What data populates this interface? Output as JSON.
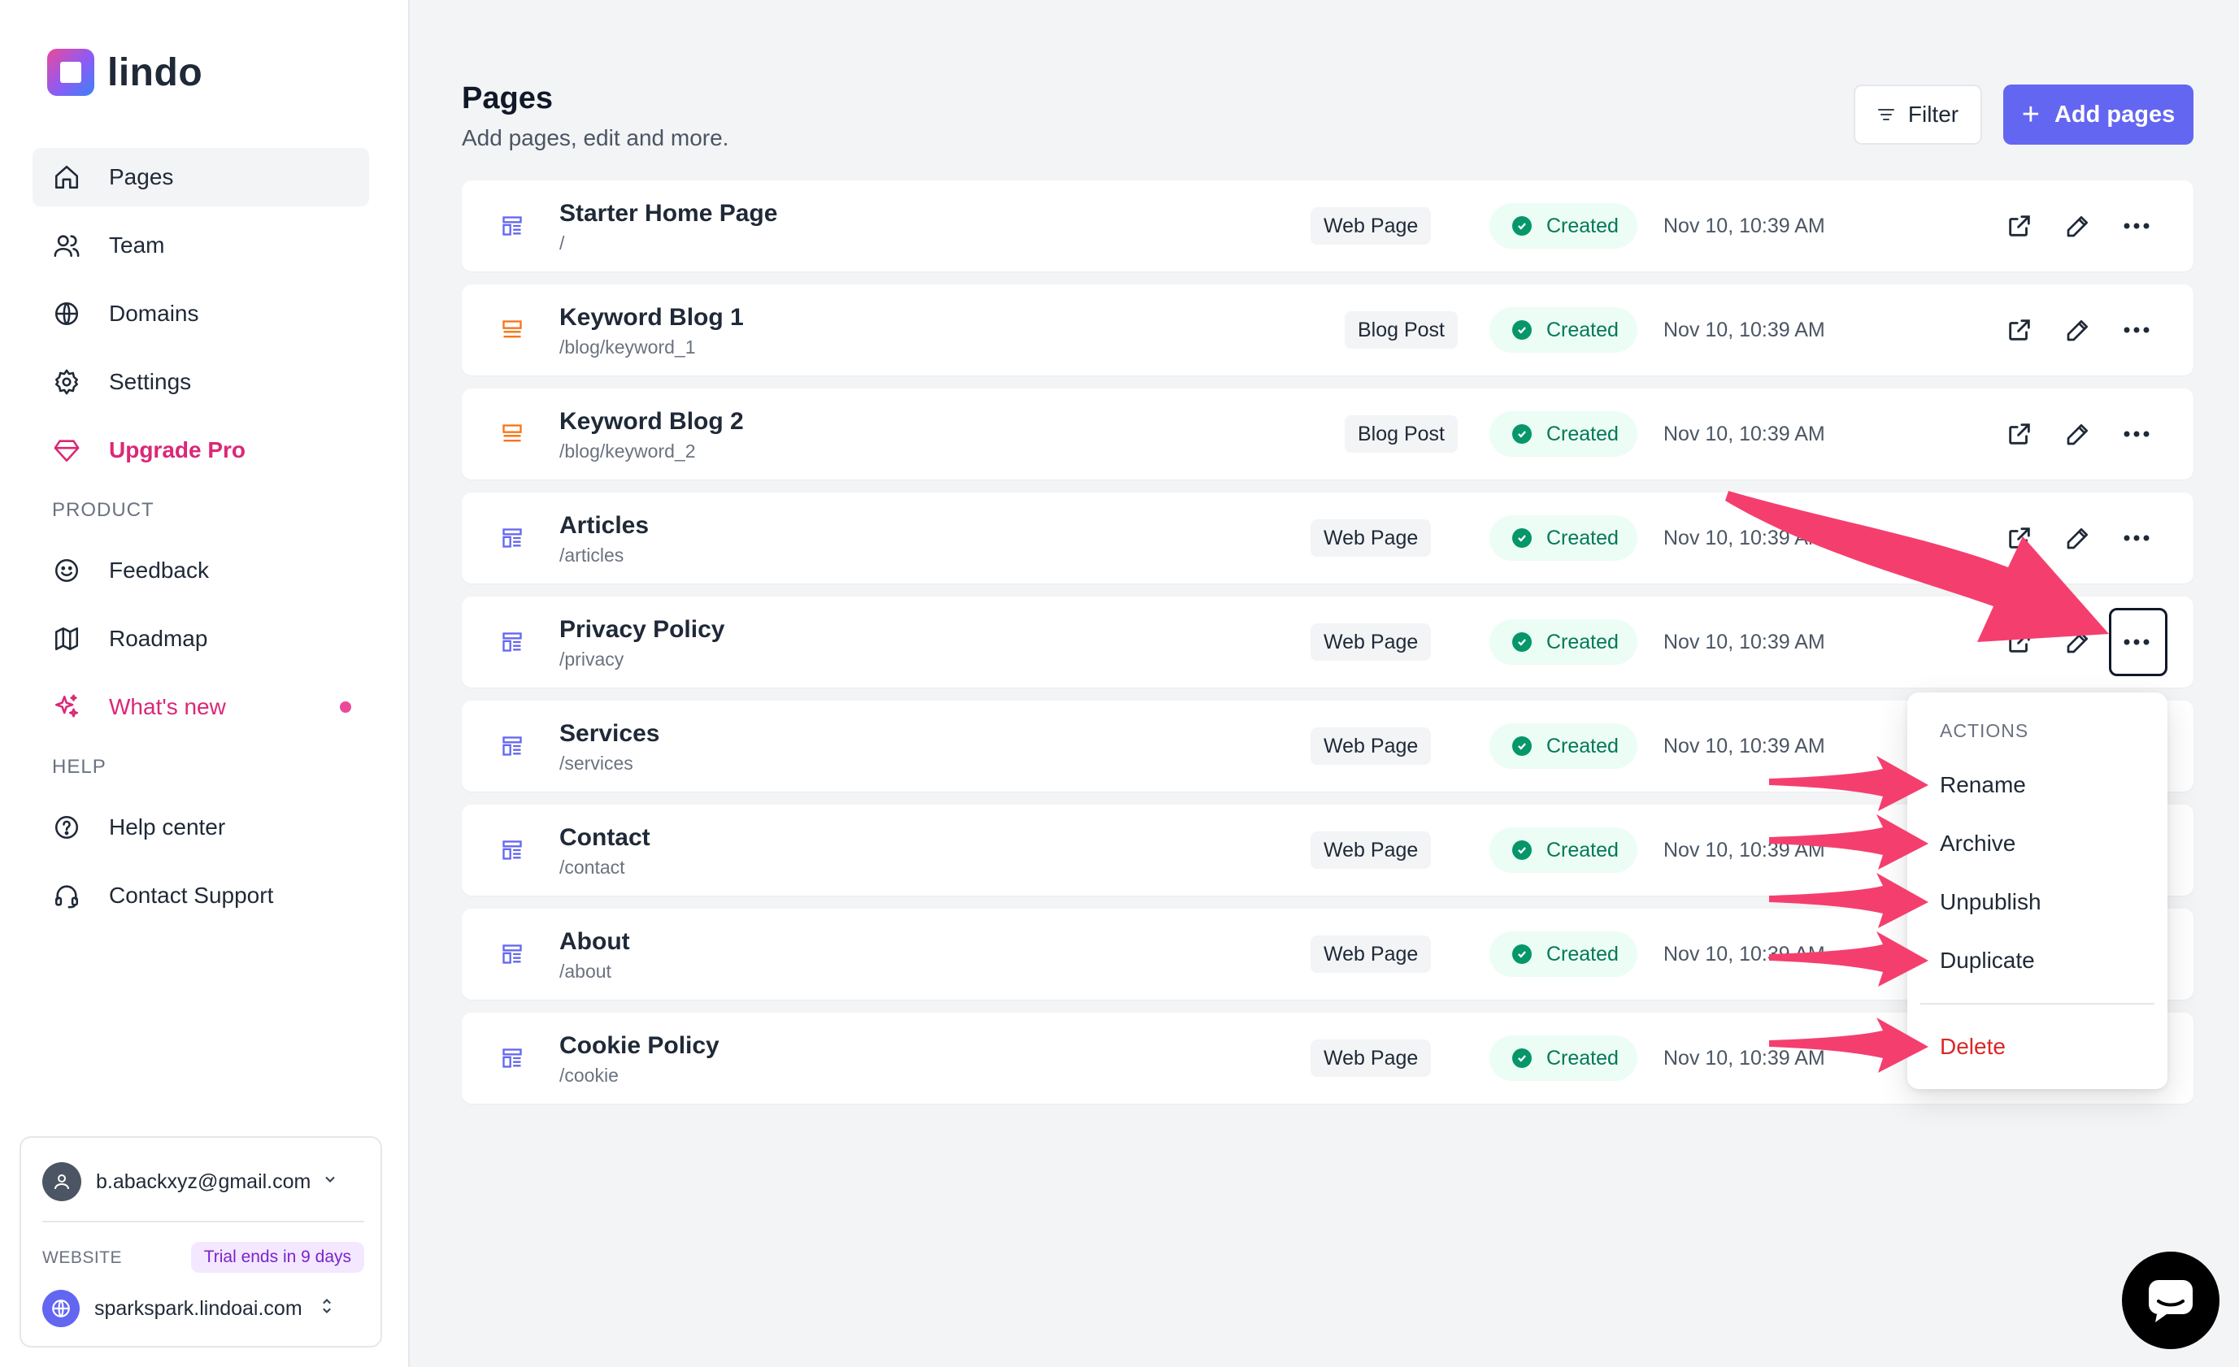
{
  "app": {
    "logo_text": "lindo"
  },
  "sidebar": {
    "items": [
      {
        "label": "Pages",
        "icon": "home-icon",
        "active": true
      },
      {
        "label": "Team",
        "icon": "users-icon"
      },
      {
        "label": "Domains",
        "icon": "globe-icon"
      },
      {
        "label": "Settings",
        "icon": "gear-icon"
      },
      {
        "label": "Upgrade Pro",
        "icon": "diamond-icon"
      }
    ],
    "product_label": "PRODUCT",
    "product_items": [
      {
        "label": "Feedback",
        "icon": "smiley-icon"
      },
      {
        "label": "Roadmap",
        "icon": "map-icon"
      },
      {
        "label": "What's new",
        "icon": "sparkle-icon"
      }
    ],
    "help_label": "HELP",
    "help_items": [
      {
        "label": "Help center",
        "icon": "question-icon"
      },
      {
        "label": "Contact Support",
        "icon": "headset-icon"
      }
    ],
    "account": {
      "email": "b.abackxyz@gmail.com",
      "website_label": "WEBSITE",
      "trial_badge": "Trial ends in 9 days",
      "site": "sparkspark.lindoai.com"
    }
  },
  "header": {
    "title": "Pages",
    "subtitle": "Add pages, edit and more.",
    "filter_label": "Filter",
    "add_label": "Add pages"
  },
  "pages": [
    {
      "title": "Starter Home Page",
      "path": "/",
      "type": "Web Page",
      "status": "Created",
      "date": "Nov 10, 10:39 AM"
    },
    {
      "title": "Keyword Blog 1",
      "path": "/blog/keyword_1",
      "type": "Blog Post",
      "status": "Created",
      "date": "Nov 10, 10:39 AM"
    },
    {
      "title": "Keyword Blog 2",
      "path": "/blog/keyword_2",
      "type": "Blog Post",
      "status": "Created",
      "date": "Nov 10, 10:39 AM"
    },
    {
      "title": "Articles",
      "path": "/articles",
      "type": "Web Page",
      "status": "Created",
      "date": "Nov 10, 10:39 AM"
    },
    {
      "title": "Privacy Policy",
      "path": "/privacy",
      "type": "Web Page",
      "status": "Created",
      "date": "Nov 10, 10:39 AM"
    },
    {
      "title": "Services",
      "path": "/services",
      "type": "Web Page",
      "status": "Created",
      "date": "Nov 10, 10:39 AM"
    },
    {
      "title": "Contact",
      "path": "/contact",
      "type": "Web Page",
      "status": "Created",
      "date": "Nov 10, 10:39 AM"
    },
    {
      "title": "About",
      "path": "/about",
      "type": "Web Page",
      "status": "Created",
      "date": "Nov 10, 10:39 AM"
    },
    {
      "title": "Cookie Policy",
      "path": "/cookie",
      "type": "Web Page",
      "status": "Created",
      "date": "Nov 10, 10:39 AM"
    }
  ],
  "actions_menu": {
    "label": "ACTIONS",
    "items": [
      "Rename",
      "Archive",
      "Unpublish",
      "Duplicate"
    ],
    "danger_item": "Delete"
  },
  "colors": {
    "accent": "#6366f1",
    "pink": "#db2777",
    "arrow": "#f43f6e",
    "success": "#059669",
    "danger": "#dc2626"
  }
}
